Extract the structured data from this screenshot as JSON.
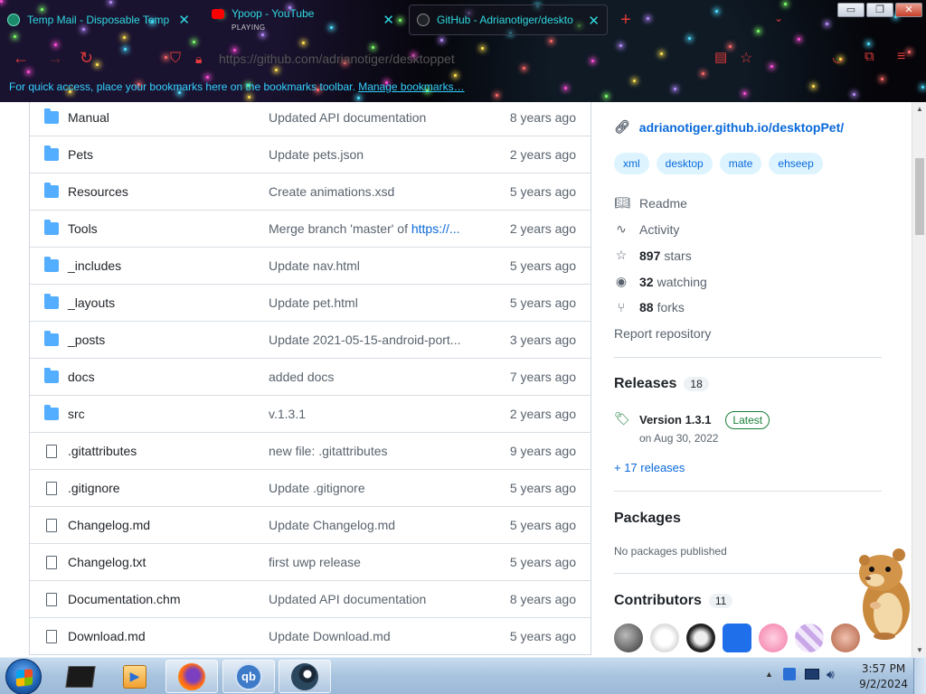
{
  "browser": {
    "tabs": [
      {
        "title": "Temp Mail - Disposable Temp",
        "sub": ""
      },
      {
        "title": "Ypoop - YouTube",
        "sub": "PLAYING"
      },
      {
        "title": "GitHub - Adrianotiger/deskto",
        "sub": ""
      }
    ],
    "url": "https://github.com/adrianotiger/desktoppet",
    "bookmarks_text": "For quick access, place your bookmarks here on the bookmarks toolbar.",
    "bookmarks_link": "Manage bookmarks…",
    "window_buttons": [
      "▭",
      "❐",
      "✕"
    ]
  },
  "files": [
    {
      "name": "Manual",
      "type": "dir",
      "message": "Updated API documentation",
      "age": "8 years ago"
    },
    {
      "name": "Pets",
      "type": "dir",
      "message": "Update pets.json",
      "age": "2 years ago"
    },
    {
      "name": "Resources",
      "type": "dir",
      "message": "Create animations.xsd",
      "age": "5 years ago"
    },
    {
      "name": "Tools",
      "type": "dir",
      "message": "Merge branch 'master' of ",
      "link": "https://...",
      "age": "2 years ago"
    },
    {
      "name": "_includes",
      "type": "dir",
      "message": "Update nav.html",
      "age": "5 years ago"
    },
    {
      "name": "_layouts",
      "type": "dir",
      "message": "Update pet.html",
      "age": "5 years ago"
    },
    {
      "name": "_posts",
      "type": "dir",
      "message": "Update 2021-05-15-android-port...",
      "age": "3 years ago"
    },
    {
      "name": "docs",
      "type": "dir",
      "message": "added docs",
      "age": "7 years ago"
    },
    {
      "name": "src",
      "type": "dir",
      "message": "v.1.3.1",
      "age": "2 years ago"
    },
    {
      "name": ".gitattributes",
      "type": "file",
      "message": "new file: .gitattributes",
      "age": "9 years ago"
    },
    {
      "name": ".gitignore",
      "type": "file",
      "message": "Update .gitignore",
      "age": "5 years ago"
    },
    {
      "name": "Changelog.md",
      "type": "file",
      "message": "Update Changelog.md",
      "age": "5 years ago"
    },
    {
      "name": "Changelog.txt",
      "type": "file",
      "message": "first uwp release",
      "age": "5 years ago"
    },
    {
      "name": "Documentation.chm",
      "type": "file",
      "message": "Updated API documentation",
      "age": "8 years ago"
    },
    {
      "name": "Download.md",
      "type": "file",
      "message": "Update Download.md",
      "age": "5 years ago"
    }
  ],
  "sidebar": {
    "homepage": "adrianotiger.github.io/desktopPet/",
    "topics": [
      "xml",
      "desktop",
      "mate",
      "ehseep"
    ],
    "readme": "Readme",
    "activity": "Activity",
    "stars_count": "897",
    "stars_label": "stars",
    "watching_count": "32",
    "watching_label": "watching",
    "forks_count": "88",
    "forks_label": "forks",
    "report": "Report repository",
    "releases_title": "Releases",
    "releases_count": "18",
    "release_name": "Version 1.3.1",
    "release_badge": "Latest",
    "release_date": "on Aug 30, 2022",
    "more_releases": "+ 17 releases",
    "packages_title": "Packages",
    "packages_text": "No packages published",
    "contributors_title": "Contributors",
    "contributors_count": "11"
  },
  "taskbar": {
    "time": "3:57 PM",
    "date": "9/2/2024"
  },
  "colors": {
    "accent": "#0969da",
    "folder": "#54aeff",
    "tab_text": "#2fd8e0",
    "nav_icon": "#e03a3a"
  }
}
